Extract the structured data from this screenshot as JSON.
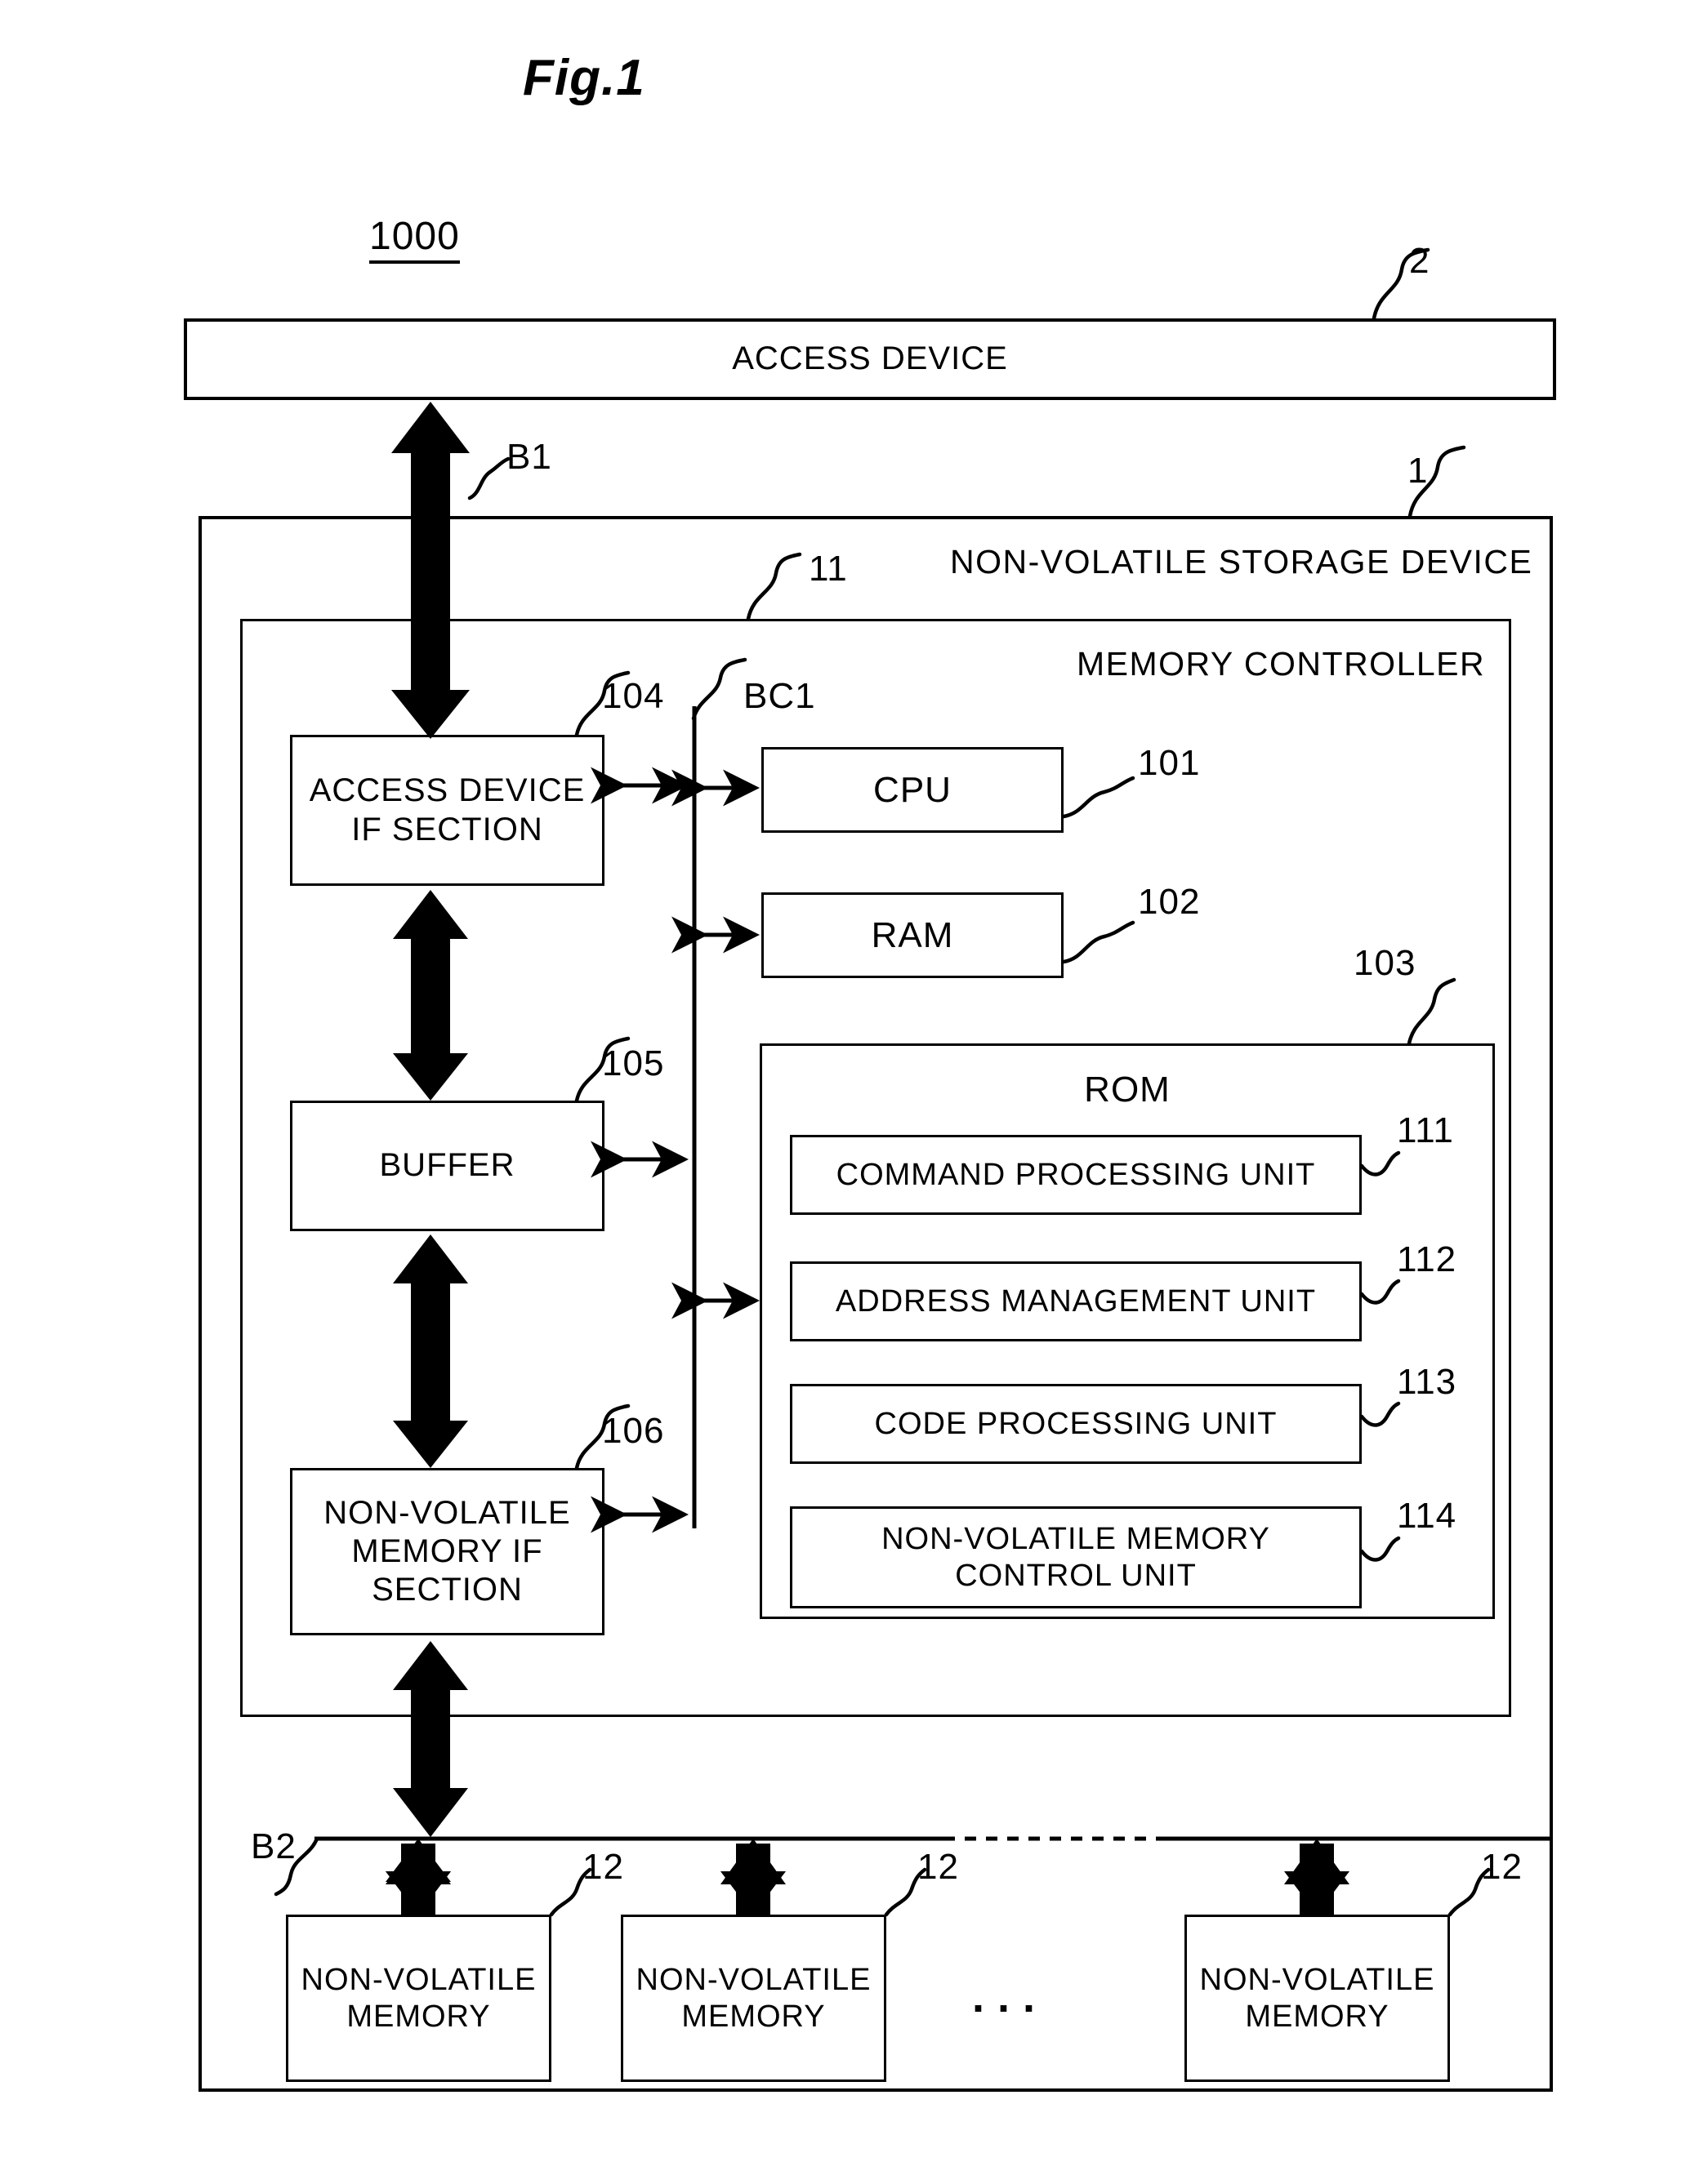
{
  "figure": {
    "title": "Fig.1",
    "system_ref": "1000"
  },
  "access_device": {
    "label": "ACCESS DEVICE",
    "ref": "2"
  },
  "bus_b1": {
    "label": "B1"
  },
  "bus_b2": {
    "label": "B2"
  },
  "bus_bc1": {
    "label": "BC1"
  },
  "storage_device": {
    "label": "NON-VOLATILE STORAGE DEVICE",
    "ref": "1"
  },
  "memory_controller": {
    "label": "MEMORY CONTROLLER",
    "ref": "11"
  },
  "blocks": {
    "access_device_if": {
      "label": "ACCESS DEVICE\nIF SECTION",
      "ref": "104"
    },
    "buffer": {
      "label": "BUFFER",
      "ref": "105"
    },
    "nvm_if": {
      "label": "NON-VOLATILE\nMEMORY IF\nSECTION",
      "ref": "106"
    },
    "cpu": {
      "label": "CPU",
      "ref": "101"
    },
    "ram": {
      "label": "RAM",
      "ref": "102"
    },
    "rom": {
      "label": "ROM",
      "ref": "103"
    }
  },
  "rom_units": [
    {
      "label": "COMMAND PROCESSING UNIT",
      "ref": "111"
    },
    {
      "label": "ADDRESS MANAGEMENT UNIT",
      "ref": "112"
    },
    {
      "label": "CODE PROCESSING UNIT",
      "ref": "113"
    },
    {
      "label": "NON-VOLATILE MEMORY\nCONTROL UNIT",
      "ref": "114"
    }
  ],
  "memories": [
    {
      "label": "NON-VOLATILE\nMEMORY",
      "ref": "12"
    },
    {
      "label": "NON-VOLATILE\nMEMORY",
      "ref": "12"
    },
    {
      "label": "NON-VOLATILE\nMEMORY",
      "ref": "12"
    }
  ],
  "ellipsis": "..."
}
